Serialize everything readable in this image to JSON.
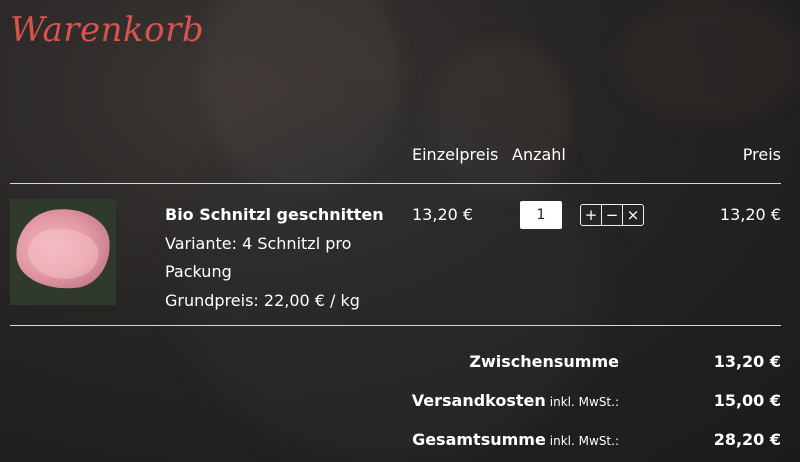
{
  "cart": {
    "title": "Warenkorb",
    "columns": {
      "unit_price": "Einzelpreis",
      "quantity": "Anzahl",
      "price": "Preis"
    },
    "items": [
      {
        "name": "Bio Schnitzl geschnitten",
        "variant_line1": "Variante: 4 Schnitzl pro",
        "variant_line2": "Packung",
        "base_price": "Grundpreis: 22,00 € / kg",
        "unit_price": "13,20 €",
        "quantity": "1",
        "line_total": "13,20 €",
        "controls": {
          "increase": "+",
          "decrease": "−",
          "remove": "×"
        }
      }
    ],
    "summary": {
      "subtotal_label": "Zwischensumme",
      "subtotal_value": "13,20 €",
      "shipping_label": "Versandkosten",
      "shipping_note": "inkl. MwSt.:",
      "shipping_value": "15,00 €",
      "total_label": "Gesamtsumme",
      "total_note": "inkl. MwSt.:",
      "total_value": "28,20 €"
    }
  }
}
